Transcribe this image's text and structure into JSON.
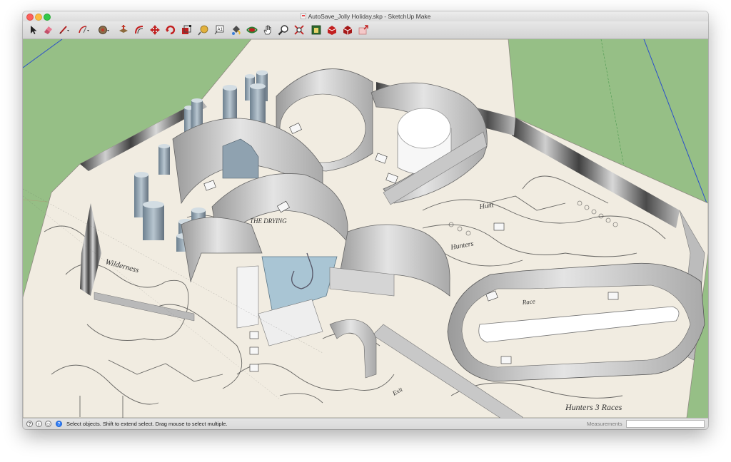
{
  "window": {
    "title": "AutoSave_Jolly Holiday.skp - SketchUp Make"
  },
  "toolbar": {
    "tools": [
      {
        "name": "select-tool-icon"
      },
      {
        "name": "eraser-tool-icon"
      },
      {
        "name": "line-tool-icon"
      },
      {
        "name": "arc-tool-icon"
      },
      {
        "name": "shapes-tool-icon"
      },
      {
        "name": "push-pull-tool-icon"
      },
      {
        "name": "offset-tool-icon"
      },
      {
        "name": "move-tool-icon"
      },
      {
        "name": "rotate-tool-icon"
      },
      {
        "name": "scale-tool-icon"
      },
      {
        "name": "tape-measure-tool-icon"
      },
      {
        "name": "text-tool-icon"
      },
      {
        "name": "paint-bucket-tool-icon"
      },
      {
        "name": "orbit-tool-icon"
      },
      {
        "name": "pan-tool-icon"
      },
      {
        "name": "zoom-tool-icon"
      },
      {
        "name": "zoom-extents-tool-icon"
      },
      {
        "name": "warehouse-icon"
      },
      {
        "name": "extension-warehouse-icon"
      },
      {
        "name": "components-icon"
      },
      {
        "name": "share-model-icon"
      }
    ]
  },
  "status": {
    "message": "Select objects. Shift to extend select. Drag mouse to select multiple.",
    "icons": [
      "geo-location-icon",
      "credits-icon",
      "user-icon",
      "help-icon"
    ]
  },
  "measurements": {
    "label": "Measurements",
    "value": ""
  },
  "model_labels": {
    "hunters_race": "Hunters  3  Races",
    "hunt": "Hunt",
    "hunters": "Hunters",
    "the_drying": "THE DRYING",
    "wilderness": "Wilderness",
    "race": "Race",
    "exit": "Exit"
  },
  "colors": {
    "ground": "#96bf86",
    "paper": "#f1ece1",
    "wall": "#c9c9c9",
    "axis_blue": "#2a4ecb",
    "water": "#a9c5d4"
  }
}
